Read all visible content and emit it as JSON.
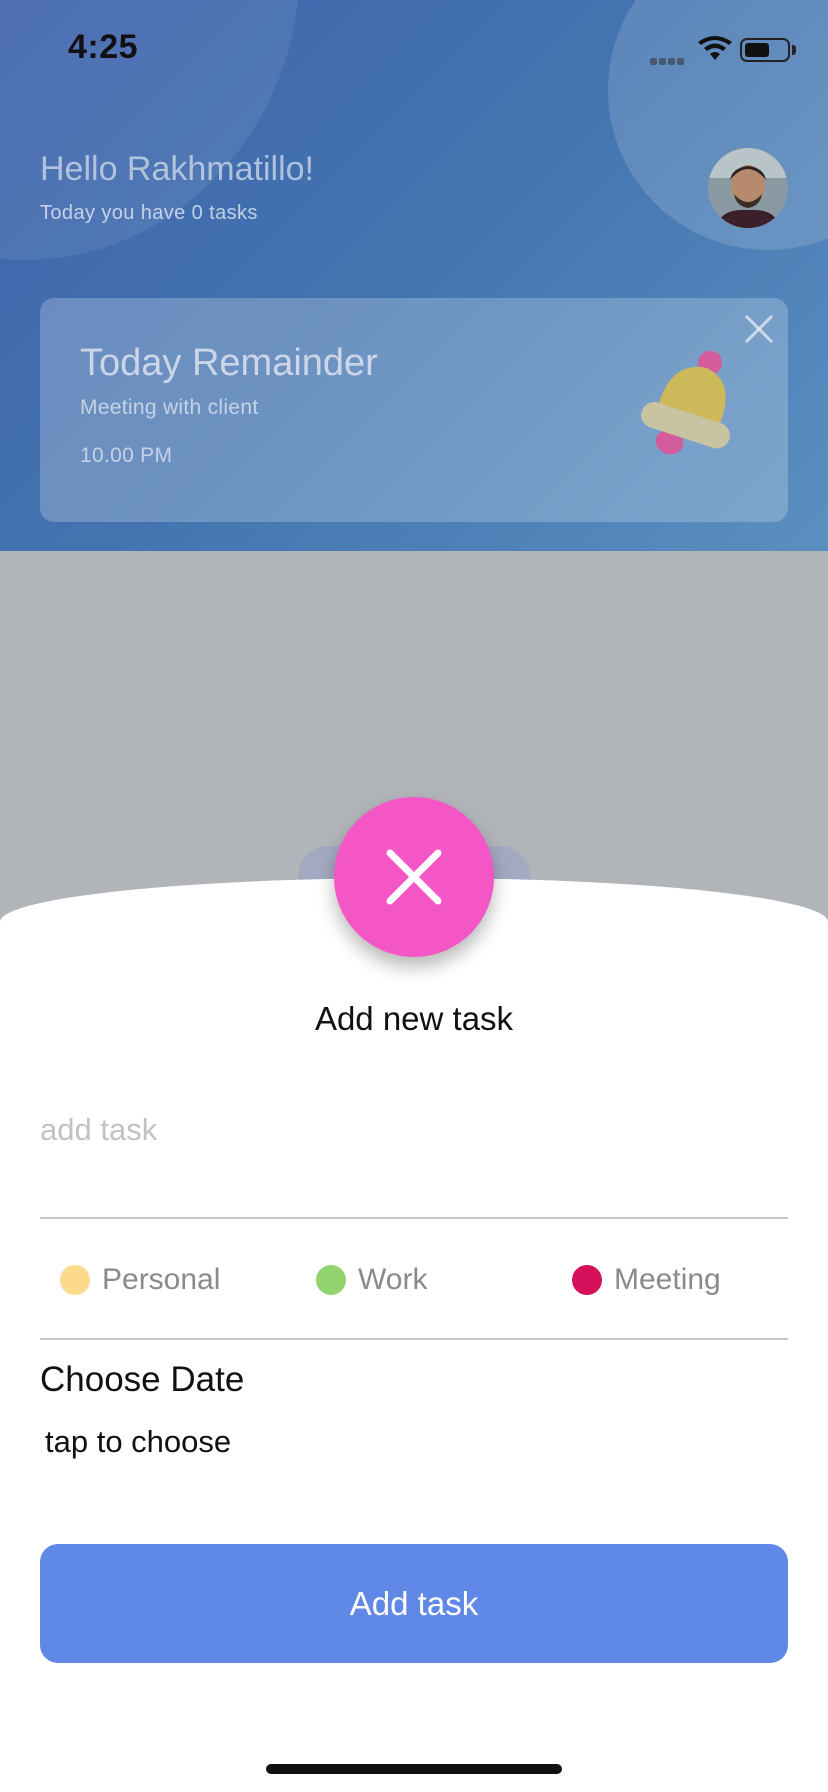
{
  "status_bar": {
    "time": "4:25",
    "icons": [
      "signal-icon",
      "wifi-icon",
      "battery-icon"
    ]
  },
  "header": {
    "greeting": "Hello Rakhmatillo!",
    "subtitle": "Today you have 0 tasks"
  },
  "reminder": {
    "title": "Today Remainder",
    "subtitle": "Meeting with client",
    "time": "10.00 PM",
    "icon": "bell-icon"
  },
  "sheet": {
    "title": "Add new task",
    "task_placeholder": "add task",
    "task_value": "",
    "categories": [
      {
        "label": "Personal",
        "color": "#fbdb8b"
      },
      {
        "label": "Work",
        "color": "#93d36f"
      },
      {
        "label": "Meeting",
        "color": "#d5105a"
      }
    ],
    "choose_date_label": "Choose Date",
    "date_value": "tap to choose",
    "add_button_label": "Add task"
  },
  "colors": {
    "fab": "#f556c6",
    "primary_button": "#6088e6",
    "header_gradient_start": "#3f63ad"
  }
}
